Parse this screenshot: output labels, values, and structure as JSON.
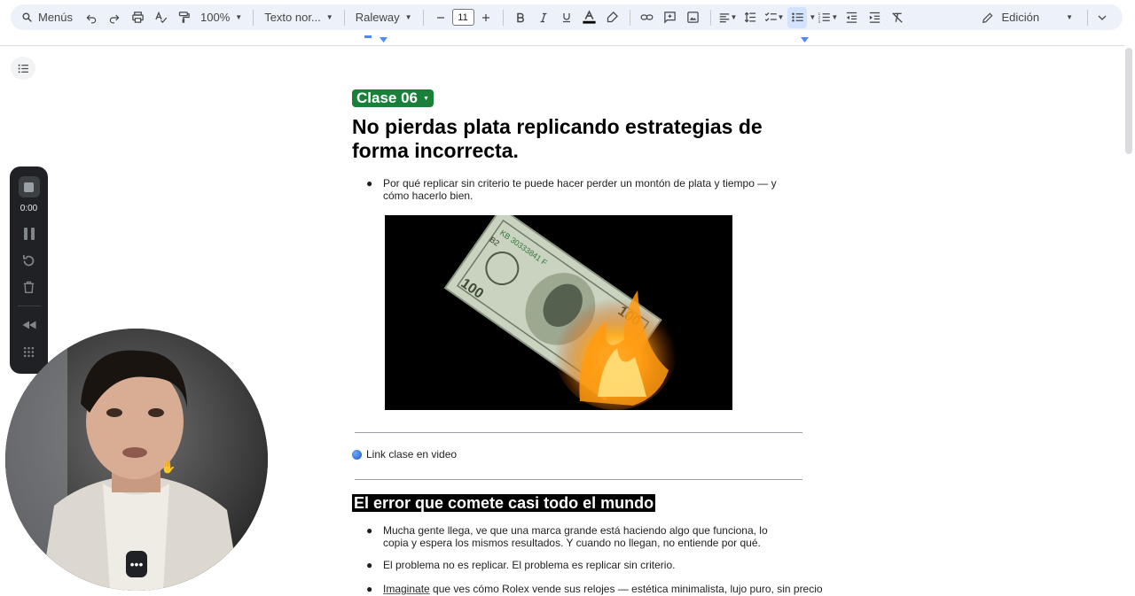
{
  "toolbar": {
    "search_label": "Menús",
    "zoom": "100%",
    "style": "Texto nor...",
    "font": "Raleway",
    "font_size": "11",
    "mode": "Edición"
  },
  "recorder": {
    "time": "0:00"
  },
  "document": {
    "chip_label": "Clase 06",
    "title": "No pierdas plata replicando estrategias de forma incorrecta.",
    "bullet1": "Por qué replicar sin criterio te puede hacer perder un montón de plata y tiempo — y cómo hacerlo bien.",
    "link_text": "Link clase en video",
    "heading2": "El error que comete casi todo el mundo",
    "bullet2": "Mucha gente llega, ve que una marca grande está haciendo algo que funciona, lo copia y espera los mismos resultados. Y cuando no llegan, no entiende por qué.",
    "bullet3": "El problema no es replicar. El problema es replicar sin criterio.",
    "bullet4_underlined": "Imaginate",
    "bullet4_rest": " que ves cómo Rolex vende sus relojes — estética minimalista, lujo puro, sin precio"
  },
  "image_texts": {
    "serial": "KB 30333841 F",
    "series": "B2"
  },
  "colors": {
    "toolbar_bg": "#edf2fa",
    "chip_green": "#188038",
    "recorder_bg": "#202124"
  }
}
